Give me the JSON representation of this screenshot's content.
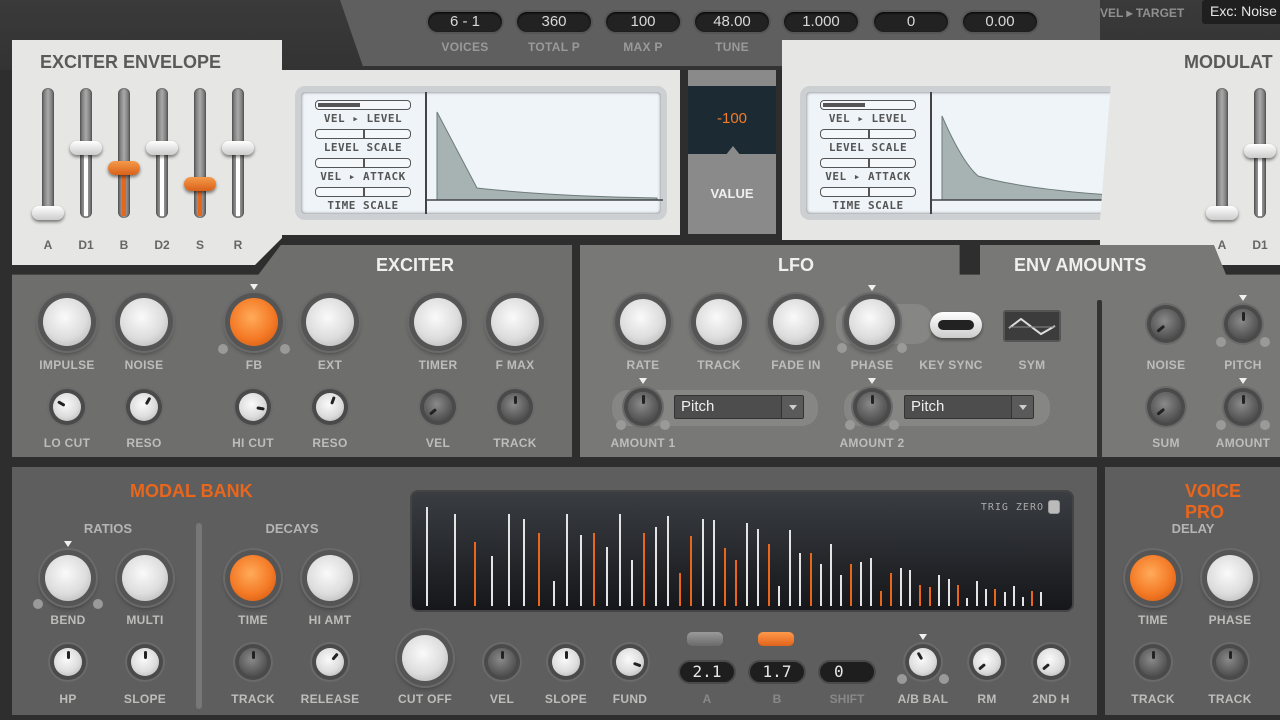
{
  "topbar": {
    "fields": [
      {
        "value": "6 - 1",
        "label": "VOICES"
      },
      {
        "value": "360",
        "label": "TOTAL P"
      },
      {
        "value": "100",
        "label": "MAX P"
      },
      {
        "value": "48.00",
        "label": "TUNE"
      },
      {
        "value": "1.000",
        "label": "TRACK"
      },
      {
        "value": "0",
        "label": "SPREAD"
      },
      {
        "value": "0.00",
        "label": "RANDOM"
      }
    ],
    "vel_target_label": "VEL ▸ TARGET",
    "vel_target_value": "Exc: Noise"
  },
  "exciter_envelope": {
    "title": "EXCITER ENVELOPE",
    "faders": [
      {
        "label": "A",
        "value": 0.0,
        "accent": false
      },
      {
        "label": "D1",
        "value": 0.55,
        "accent": false
      },
      {
        "label": "B",
        "value": 0.38,
        "accent": true
      },
      {
        "label": "D2",
        "value": 0.55,
        "accent": false
      },
      {
        "label": "S",
        "value": 0.25,
        "accent": true
      },
      {
        "label": "R",
        "value": 0.55,
        "accent": false
      }
    ],
    "screen": {
      "rows": [
        "VEL ▸ LEVEL",
        "LEVEL SCALE",
        "VEL ▸ ATTACK",
        "TIME SCALE"
      ],
      "vel_level_fill": 0.45
    }
  },
  "value_display": {
    "value": "-100",
    "label": "VALUE"
  },
  "modulation_envelope": {
    "title": "MODULAT",
    "screen": {
      "rows": [
        "VEL ▸ LEVEL",
        "LEVEL SCALE",
        "VEL ▸ ATTACK",
        "TIME SCALE"
      ],
      "vel_level_fill": 0.45
    },
    "fader_labels": [
      "A",
      "D1"
    ]
  },
  "exciter": {
    "title": "EXCITER",
    "knobs_top": [
      "IMPULSE",
      "NOISE",
      "FB",
      "EXT",
      "TIMER",
      "F MAX"
    ],
    "knobs_bottom": [
      "LO CUT",
      "RESO",
      "HI CUT",
      "RESO",
      "VEL",
      "TRACK"
    ]
  },
  "lfo": {
    "title": "LFO",
    "knobs_top": [
      "RATE",
      "TRACK",
      "FADE IN",
      "PHASE"
    ],
    "key_sync_label": "KEY SYNC",
    "sym_label": "SYM",
    "amount1_label": "AMOUNT 1",
    "amount1_target": "Pitch",
    "amount2_label": "AMOUNT 2",
    "amount2_target": "Pitch"
  },
  "env_amounts": {
    "title": "ENV AMOUNTS",
    "knobs": [
      "NOISE",
      "PITCH",
      "SUM",
      "AMOUNT"
    ]
  },
  "modal_bank": {
    "title": "MODAL BANK",
    "ratios_label": "RATIOS",
    "decays_label": "DECAYS",
    "ratios_top": [
      "BEND",
      "MULTI"
    ],
    "ratios_bottom": [
      "HP",
      "SLOPE"
    ],
    "decays_top": [
      "TIME",
      "HI AMT"
    ],
    "decays_bottom": [
      "TRACK",
      "RELEASE"
    ],
    "trig_zero_label": "TRIG ZERO",
    "bottom_knobs": [
      "CUT OFF",
      "VEL",
      "SLOPE",
      "FUND"
    ],
    "a_value": "2.1",
    "a_label": "A",
    "b_value": "1.7",
    "b_label": "B",
    "shift_value": "0",
    "shift_label": "SHIFT",
    "right_knobs": [
      "A/B BAL",
      "RM",
      "2ND H"
    ],
    "spectrum": [
      {
        "h": 0.95,
        "c": "w"
      },
      {
        "h": 0.88,
        "c": "w"
      },
      {
        "h": 0.62,
        "c": "o"
      },
      {
        "h": 0.48,
        "c": "w"
      },
      {
        "h": 0.88,
        "c": "w"
      },
      {
        "h": 0.84,
        "c": "w"
      },
      {
        "h": 0.7,
        "c": "o"
      },
      {
        "h": 0.24,
        "c": "w"
      },
      {
        "h": 0.88,
        "c": "w"
      },
      {
        "h": 0.68,
        "c": "w"
      },
      {
        "h": 0.7,
        "c": "o"
      },
      {
        "h": 0.57,
        "c": "w"
      },
      {
        "h": 0.88,
        "c": "w"
      },
      {
        "h": 0.44,
        "c": "w"
      },
      {
        "h": 0.7,
        "c": "o"
      },
      {
        "h": 0.76,
        "c": "w"
      },
      {
        "h": 0.87,
        "c": "w"
      },
      {
        "h": 0.32,
        "c": "o"
      },
      {
        "h": 0.67,
        "c": "o"
      },
      {
        "h": 0.84,
        "c": "w"
      },
      {
        "h": 0.83,
        "c": "w"
      },
      {
        "h": 0.56,
        "c": "o"
      },
      {
        "h": 0.44,
        "c": "o"
      },
      {
        "h": 0.8,
        "c": "w"
      },
      {
        "h": 0.74,
        "c": "w"
      },
      {
        "h": 0.6,
        "c": "o"
      },
      {
        "h": 0.19,
        "c": "w"
      },
      {
        "h": 0.73,
        "c": "w"
      },
      {
        "h": 0.51,
        "c": "w"
      },
      {
        "h": 0.51,
        "c": "o"
      },
      {
        "h": 0.4,
        "c": "w"
      },
      {
        "h": 0.6,
        "c": "w"
      },
      {
        "h": 0.3,
        "c": "w"
      },
      {
        "h": 0.4,
        "c": "o"
      },
      {
        "h": 0.42,
        "c": "w"
      },
      {
        "h": 0.46,
        "c": "w"
      },
      {
        "h": 0.14,
        "c": "o"
      },
      {
        "h": 0.32,
        "c": "o"
      },
      {
        "h": 0.37,
        "c": "w"
      },
      {
        "h": 0.35,
        "c": "w"
      },
      {
        "h": 0.2,
        "c": "o"
      },
      {
        "h": 0.18,
        "c": "o"
      },
      {
        "h": 0.3,
        "c": "w"
      },
      {
        "h": 0.26,
        "c": "w"
      },
      {
        "h": 0.2,
        "c": "o"
      },
      {
        "h": 0.08,
        "c": "w"
      },
      {
        "h": 0.24,
        "c": "w"
      },
      {
        "h": 0.16,
        "c": "w"
      },
      {
        "h": 0.16,
        "c": "o"
      },
      {
        "h": 0.13,
        "c": "w"
      },
      {
        "h": 0.19,
        "c": "w"
      },
      {
        "h": 0.09,
        "c": "w"
      },
      {
        "h": 0.14,
        "c": "o"
      },
      {
        "h": 0.13,
        "c": "w"
      }
    ]
  },
  "voice_processing": {
    "title": "VOICE PRO",
    "delay_label": "DELAY",
    "knobs_top": [
      "TIME",
      "PHASE"
    ],
    "knobs_bottom": [
      "TRACK",
      "TRACK"
    ]
  },
  "colors": {
    "accent": "#e8671d",
    "panel_light": "#e6e6e4",
    "panel_dark": "#6e6e6c"
  }
}
